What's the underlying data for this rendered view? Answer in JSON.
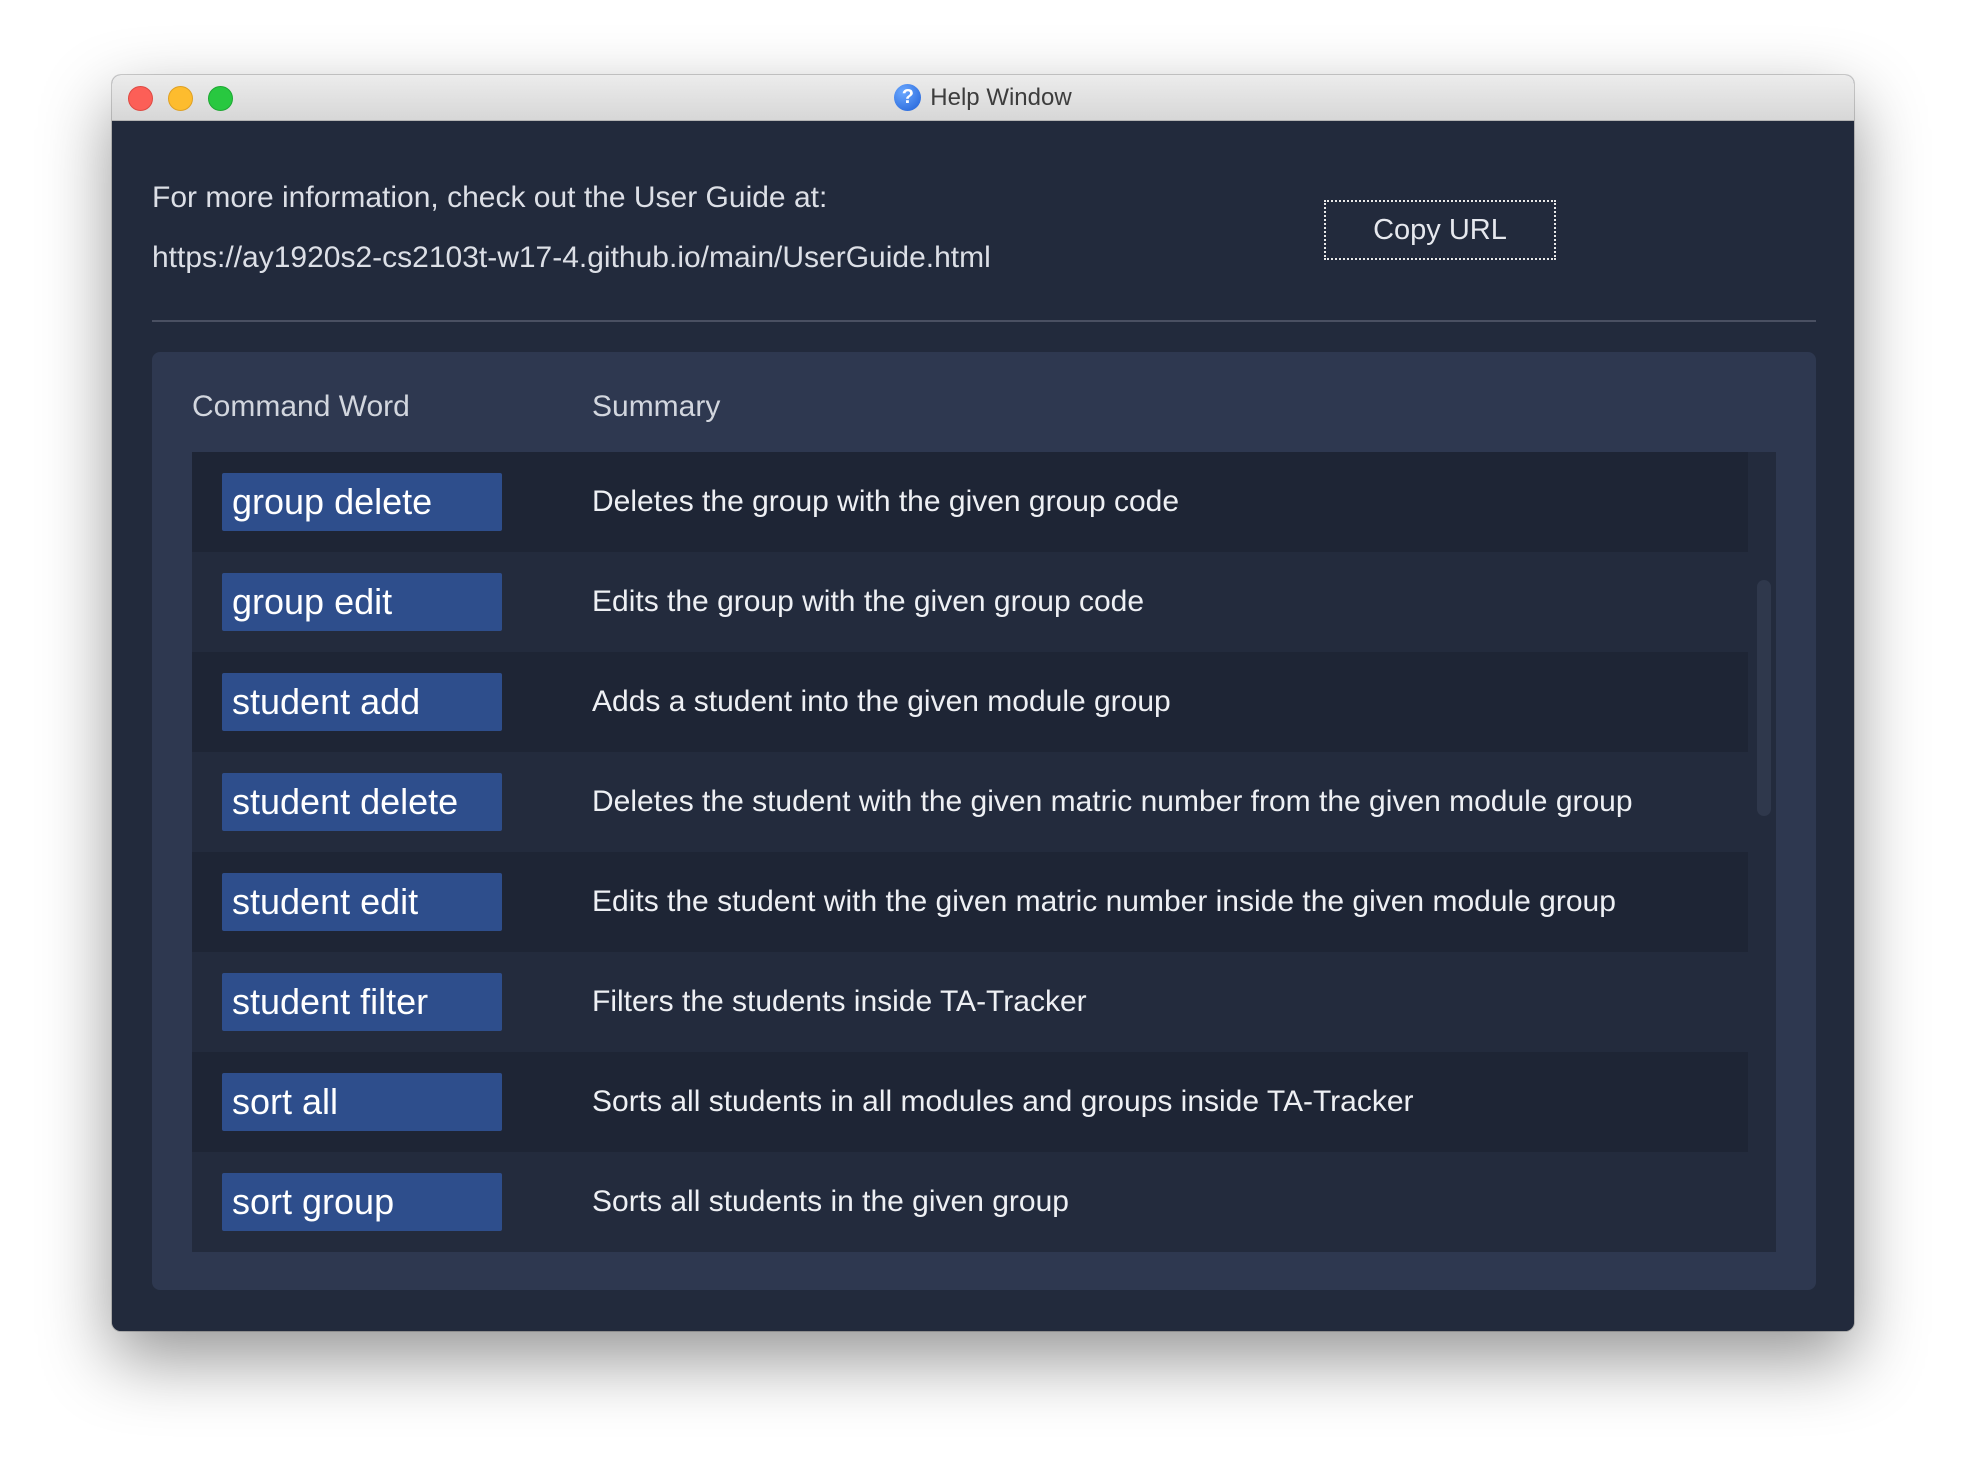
{
  "window": {
    "title": "Help Window"
  },
  "info": {
    "line1": "For more information, check out the User Guide at:",
    "url": "https://ay1920s2-cs2103t-w17-4.github.io/main/UserGuide.html",
    "copy_button": "Copy URL"
  },
  "table": {
    "headers": [
      "Command Word",
      "Summary"
    ],
    "rows": [
      {
        "command": "group delete",
        "summary": "Deletes the group with the given group code"
      },
      {
        "command": "group edit",
        "summary": "Edits the group with the given group code"
      },
      {
        "command": "student add",
        "summary": "Adds a student into the given module group"
      },
      {
        "command": "student delete",
        "summary": "Deletes the student with the given matric number from the given module group"
      },
      {
        "command": "student edit",
        "summary": "Edits the student with the given matric number inside the given module group"
      },
      {
        "command": "student filter",
        "summary": "Filters the students inside TA-Tracker"
      },
      {
        "command": "sort all",
        "summary": "Sorts all students in all modules and groups inside TA-Tracker"
      },
      {
        "command": "sort group",
        "summary": "Sorts all students in the given group"
      }
    ]
  },
  "colors": {
    "background": "#222a3c",
    "panel": "#2e3850",
    "command_chip": "#2e4e8c"
  },
  "icons": {
    "title_icon": "help-question-icon"
  }
}
